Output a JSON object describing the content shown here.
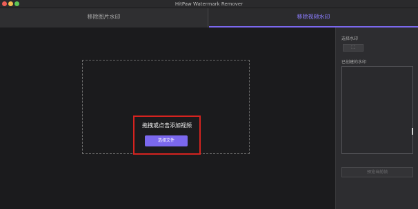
{
  "window": {
    "title": "HitPaw Watermark Remover"
  },
  "tabs": [
    {
      "label": "移除图片水印",
      "active": false
    },
    {
      "label": "移除视频水印",
      "active": true
    }
  ],
  "main": {
    "drop_text": "拖拽或点击添加视频",
    "select_file_label": "选择文件"
  },
  "sidebar": {
    "select_watermark_label": "选择水印",
    "created_watermarks_label": "已创建的水印",
    "action_button_label": "预览当前帧"
  },
  "colors": {
    "accent": "#7b68ee",
    "highlight": "#d6231f",
    "background": "#1b1b1d"
  }
}
